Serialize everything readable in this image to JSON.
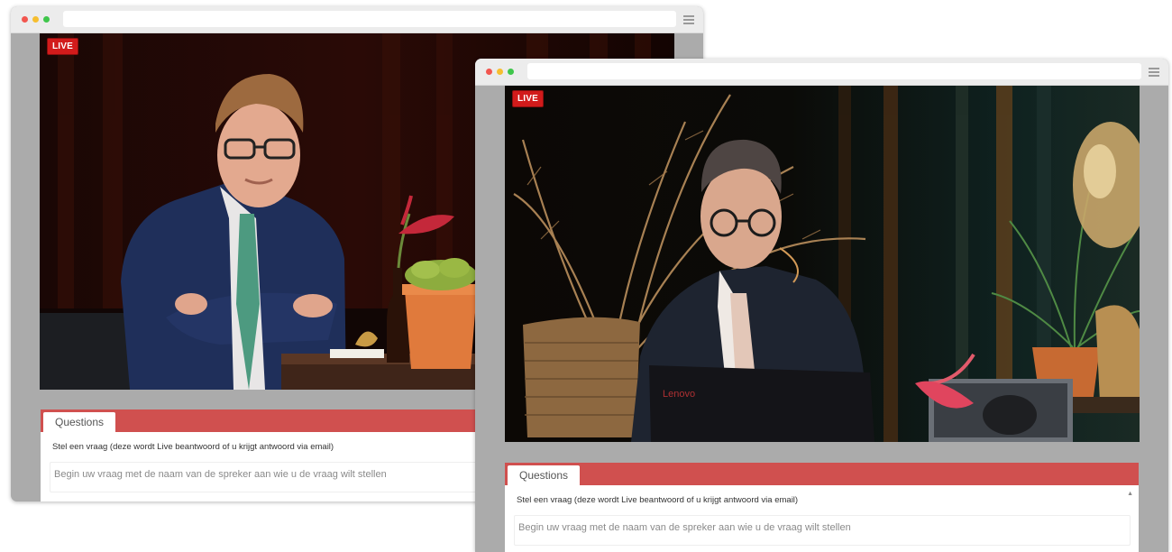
{
  "windows": [
    {
      "id": "win1",
      "live_badge": "LIVE",
      "questions": {
        "tab_label": "Questions",
        "label": "Stel een vraag (deze wordt Live beantwoord of u krijgt antwoord via email)",
        "input_placeholder": "Begin uw vraag met de naam van de spreker aan wie u de vraag wilt stellen"
      }
    },
    {
      "id": "win2",
      "live_badge": "LIVE",
      "laptop_brand": "Lenovo",
      "questions": {
        "tab_label": "Questions",
        "label": "Stel een vraag (deze wordt Live beantwoord of u krijgt antwoord via email)",
        "input_placeholder": "Begin uw vraag met de naam van de spreker aan wie u de vraag wilt stellen"
      }
    }
  ],
  "colors": {
    "live_red": "#d21b1b",
    "questions_bar": "#d0504f",
    "browser_frame": "#ababab"
  }
}
